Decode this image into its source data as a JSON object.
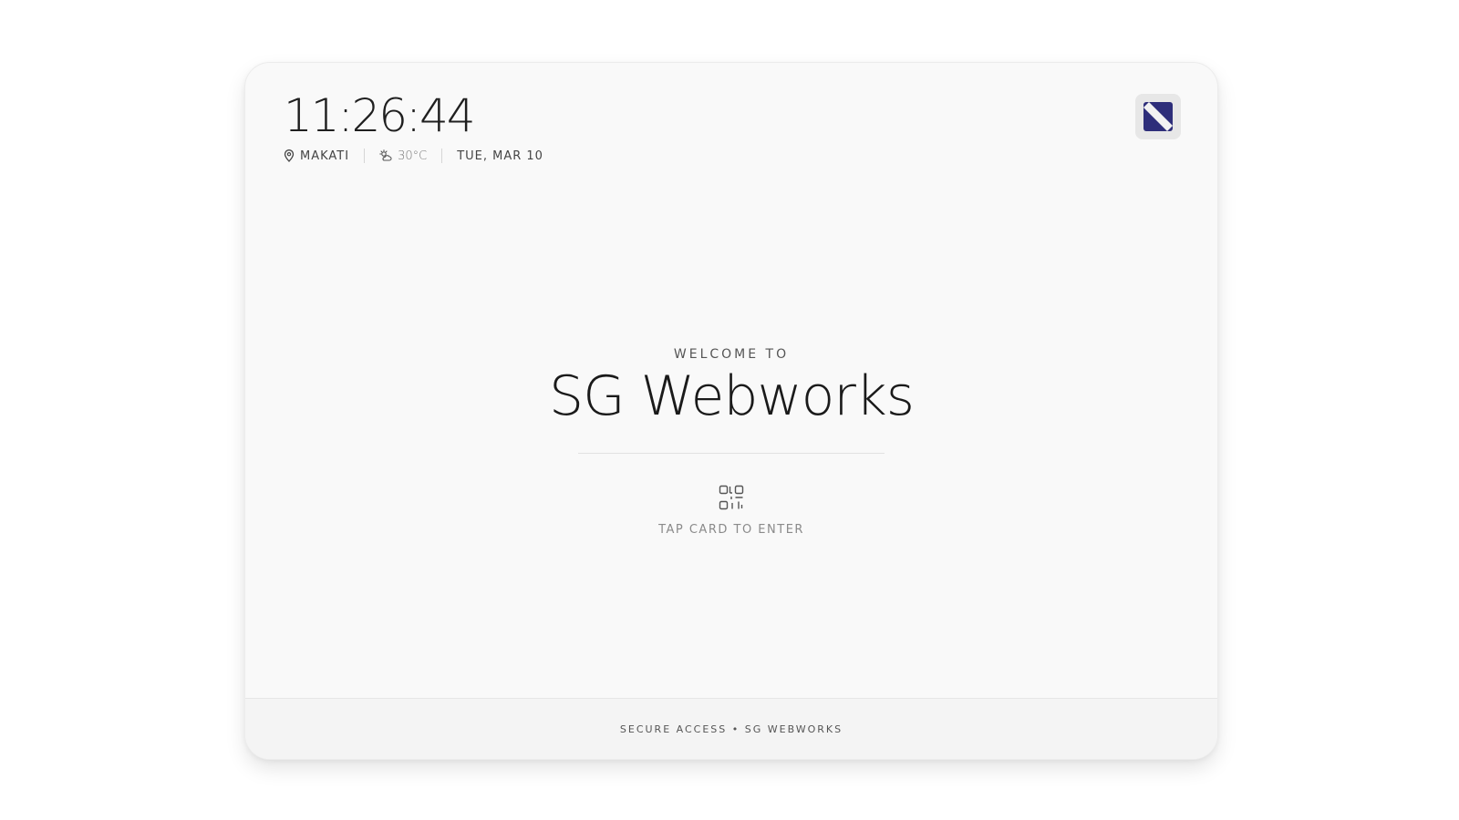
{
  "header": {
    "time": "11:26:44",
    "location": "MAKATI",
    "temperature": "30°C",
    "date": "TUE, MAR 10",
    "location_icon": "map-pin-icon",
    "weather_icon": "partly-sunny-icon",
    "logo_icon": "sg-webworks-logo"
  },
  "main": {
    "welcome": "WELCOME TO",
    "company": "SG Webworks",
    "tap_icon": "qr-scan-icon",
    "tap_label": "TAP CARD TO ENTER"
  },
  "footer": {
    "text": "SECURE ACCESS • SG WEBWORKS"
  },
  "colors": {
    "logo_accent": "#2e2e7a",
    "panel_bg": "#f9f9f9"
  }
}
